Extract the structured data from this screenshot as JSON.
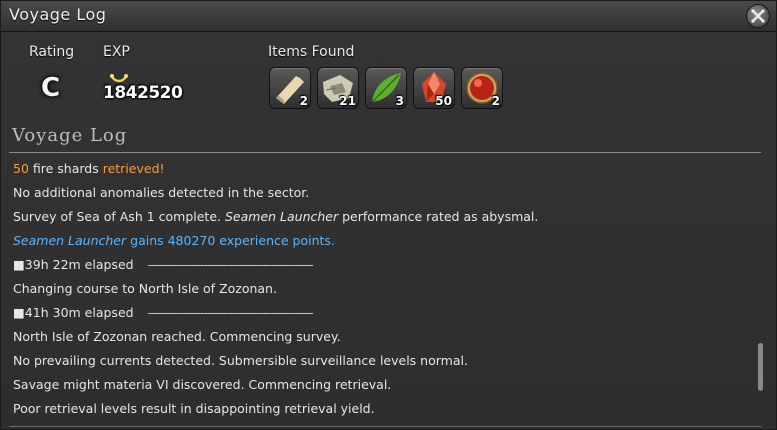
{
  "window": {
    "title": "Voyage Log"
  },
  "summary": {
    "rating_label": "Rating",
    "rating_value": "C",
    "exp_label": "EXP",
    "exp_value": "1842520",
    "items_label": "Items Found"
  },
  "items": [
    {
      "icon": "lumber-icon",
      "qty": "2"
    },
    {
      "icon": "map-fragment-icon",
      "qty": "21"
    },
    {
      "icon": "leaf-icon",
      "qty": "3"
    },
    {
      "icon": "fire-shard-icon",
      "qty": "50"
    },
    {
      "icon": "materia-icon",
      "qty": "2"
    }
  ],
  "log": {
    "header": "Voyage Log",
    "lines": {
      "l1": {
        "a": "50",
        "b": " fire shards ",
        "c": "retrieved!"
      },
      "l2": "No additional anomalies detected in the sector.",
      "l3": {
        "a": "Survey of Sea of Ash 1 complete. ",
        "b": "Seamen Launcher",
        "c": " performance rated as abysmal."
      },
      "l4": {
        "a": "Seamen Launcher",
        "b": " gains 480270  experience points."
      },
      "l5": {
        "a": "■39h 22m elapsed",
        "b": "-----------------------------------------------"
      },
      "l6": "Changing course to North Isle of Zozonan.",
      "l7": {
        "a": "■41h 30m elapsed",
        "b": "-----------------------------------------------"
      },
      "l8": "North Isle of Zozonan reached. Commencing survey.",
      "l9": "No prevailing currents detected. Submersible surveillance levels normal.",
      "l10": "Savage might materia VI discovered. Commencing retrieval.",
      "l11": "Poor retrieval levels result in disappointing retrieval yield."
    }
  },
  "colors": {
    "orange": "#ff9a3a",
    "blue": "#5ab4ff"
  }
}
